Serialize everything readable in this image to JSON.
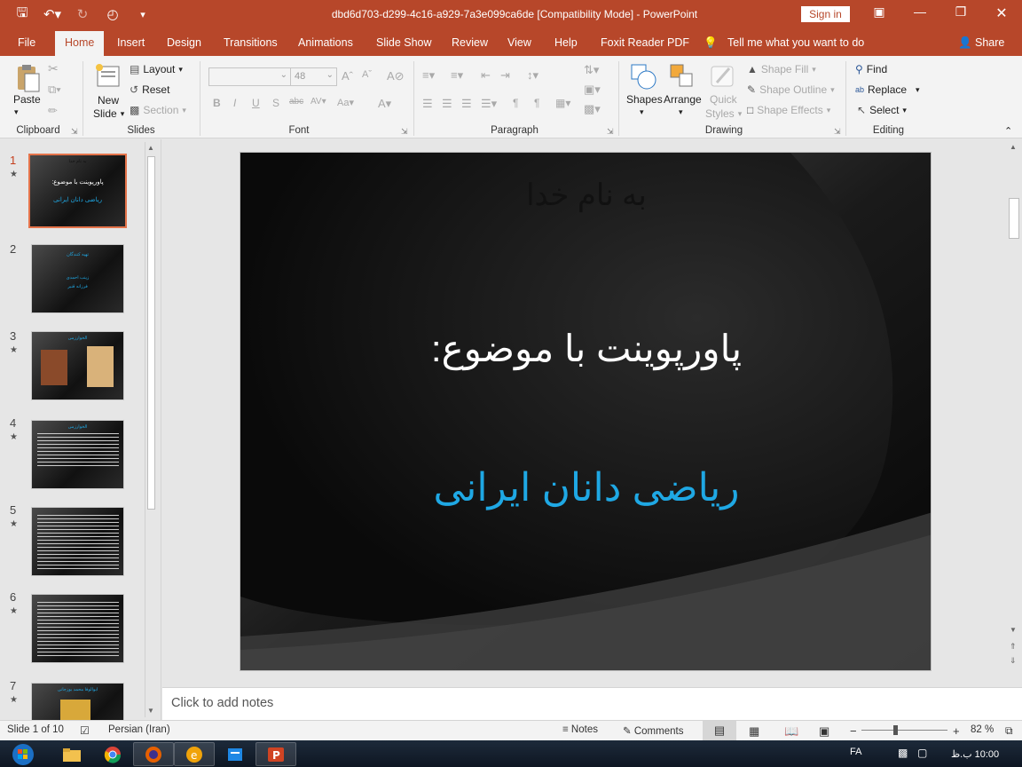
{
  "titlebar": {
    "doc_title": "dbd6d703-d299-4c16-a929-7a3e099ca6de [Compatibility Mode]  -  PowerPoint",
    "sign_in": "Sign in"
  },
  "tabs": {
    "file": "File",
    "home": "Home",
    "insert": "Insert",
    "design": "Design",
    "transitions": "Transitions",
    "animations": "Animations",
    "slideshow": "Slide Show",
    "review": "Review",
    "view": "View",
    "help": "Help",
    "foxit": "Foxit Reader PDF",
    "tellme": "Tell me what you want to do",
    "share": "Share"
  },
  "ribbon": {
    "clipboard": {
      "label": "Clipboard",
      "paste": "Paste"
    },
    "slides": {
      "label": "Slides",
      "new_slide_1": "New",
      "new_slide_2": "Slide",
      "layout": "Layout",
      "reset": "Reset",
      "section": "Section"
    },
    "font": {
      "label": "Font",
      "size": "48"
    },
    "paragraph": {
      "label": "Paragraph"
    },
    "drawing": {
      "label": "Drawing",
      "shapes": "Shapes",
      "arrange": "Arrange",
      "quick_styles_1": "Quick",
      "quick_styles_2": "Styles",
      "shape_fill": "Shape Fill",
      "shape_outline": "Shape Outline",
      "shape_effects": "Shape Effects"
    },
    "editing": {
      "label": "Editing",
      "find": "Find",
      "replace": "Replace",
      "select": "Select"
    }
  },
  "thumbnails": [
    {
      "num": "1",
      "caption1": "به نام خدا",
      "caption2": "پاورپوینت با موضوع:",
      "caption3": "ریاضی دانان ایرانی"
    },
    {
      "num": "2",
      "caption1": "تهیه کنندگان",
      "caption2": "زینب احمدی",
      "caption3": "فرزانه قنبر"
    },
    {
      "num": "3",
      "caption1": "الخوارزمی"
    },
    {
      "num": "4",
      "caption1": "الخوارزمی"
    },
    {
      "num": "5"
    },
    {
      "num": "6"
    },
    {
      "num": "7",
      "caption1": "ابوالوفا محمد بوزجانی"
    }
  ],
  "slide": {
    "line1": "به نام خدا",
    "line2": "پاورپوینت با موضوع:",
    "line3": "ریاضی دانان ایرانی"
  },
  "notes": {
    "placeholder": "Click to add notes"
  },
  "status": {
    "slide_of": "Slide 1 of 10",
    "language": "Persian (Iran)",
    "notes": "Notes",
    "comments": "Comments",
    "zoom": "82 %"
  },
  "taskbar": {
    "lang": "FA",
    "time": "10:00 ب.ظ"
  },
  "colors": {
    "accent": "#b7472a",
    "slide_title_blue": "#1fa8e4"
  }
}
